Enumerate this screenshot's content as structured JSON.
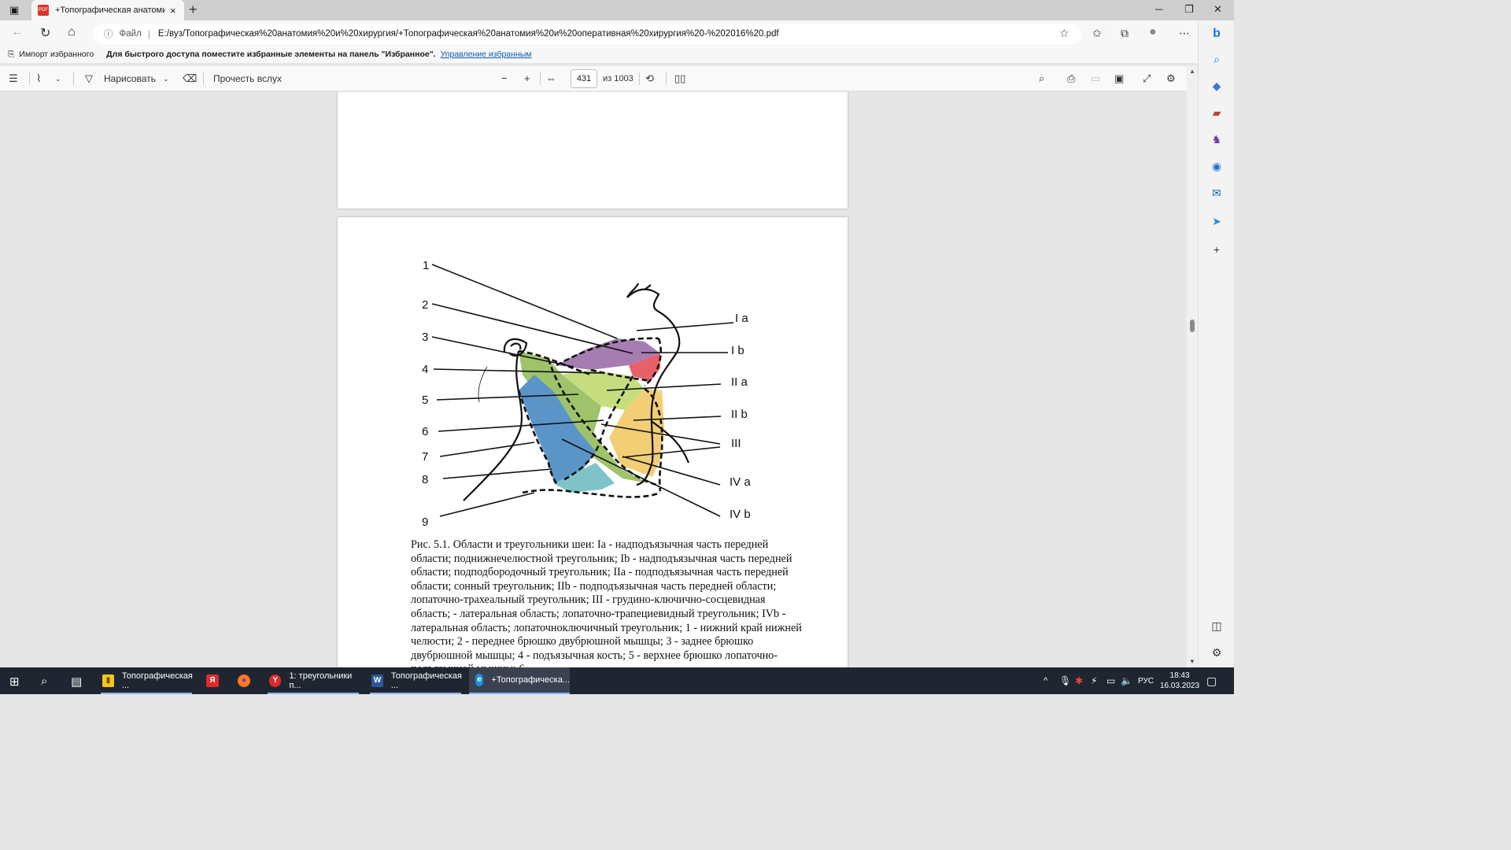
{
  "tab": {
    "title": "+Топографическая анатомия и оперативная хирургия",
    "close_icon": "×",
    "new_tab_icon": "+"
  },
  "window_controls": {
    "minimize": "─",
    "restore": "❐",
    "close": "✕"
  },
  "address": {
    "scheme_label": "Файл",
    "url": "E:/вуз/Топографическая%20анатомия%20и%20хирургия/+Топографическая%20анатомия%20и%20оперативная%20хирургия%20-%202016%20.pdf"
  },
  "favorites_bar": {
    "import_label": "Импорт избранного",
    "hint": "Для быстрого доступа поместите избранные элементы на панель \"Избранное\".",
    "manage_link": "Управление избранным"
  },
  "pdf_toolbar": {
    "draw_label": "Нарисовать",
    "read_aloud_label": "Прочесть вслух",
    "page_current": "431",
    "page_total": "из 1003"
  },
  "figure": {
    "left_labels": [
      "1",
      "2",
      "3",
      "4",
      "5",
      "6",
      "7",
      "8",
      "9"
    ],
    "right_labels": [
      "I a",
      "I b",
      "II a",
      "II b",
      "III",
      "IV a",
      "IV b"
    ],
    "colors": {
      "purple": "#a57db2",
      "red": "#e8606a",
      "lightgreen": "#c6dd7e",
      "green": "#9ec36a",
      "blue": "#5b95c8",
      "teal": "#7fc3c9",
      "orange": "#f2cf75"
    }
  },
  "caption": "Рис. 5.1. Области и треугольники шеи: Iа - надподъязычная часть передней области; поднижнечелюстной треугольник; Ib - надподъязычная часть передней области; подподбородочный треугольник; IIа - подподъязычная часть передней области; сонный треугольник; IIb - подподъязычная часть передней области; лопаточно-трахеальный треугольник; III - грудино-ключично-сосцевидная область; - латеральная область; лопаточно-трапециевидный треугольник; IVb - латеральная область; лопаточноключичный треугольник; 1 - нижний край нижней челюсти; 2 - переднее брюшко двубрюшной мышцы; 3 - заднее брюшко двубрюшной мышцы; 4 - подъязычная кость; 5 - верхнее брюшко лопаточно-подъязычной мышцы; 6 -",
  "taskbar": {
    "apps": [
      {
        "label": "Топографическая ...",
        "badge": "▮",
        "color": "#f5c518"
      },
      {
        "label": "",
        "badge": "Я",
        "color": "#e02a2a"
      },
      {
        "label": "",
        "badge": "●",
        "color": "#ff7a1a"
      },
      {
        "label": "1: треугольники п...",
        "badge": "Y",
        "color": "#e02a2a"
      },
      {
        "label": "Топографическая ...",
        "badge": "W",
        "color": "#2b5797"
      },
      {
        "label": "+Топографическа...",
        "badge": "e",
        "color": "#1a8fd6"
      }
    ],
    "lang": "РУС",
    "time": "18:43",
    "date": "16.03.2023"
  }
}
